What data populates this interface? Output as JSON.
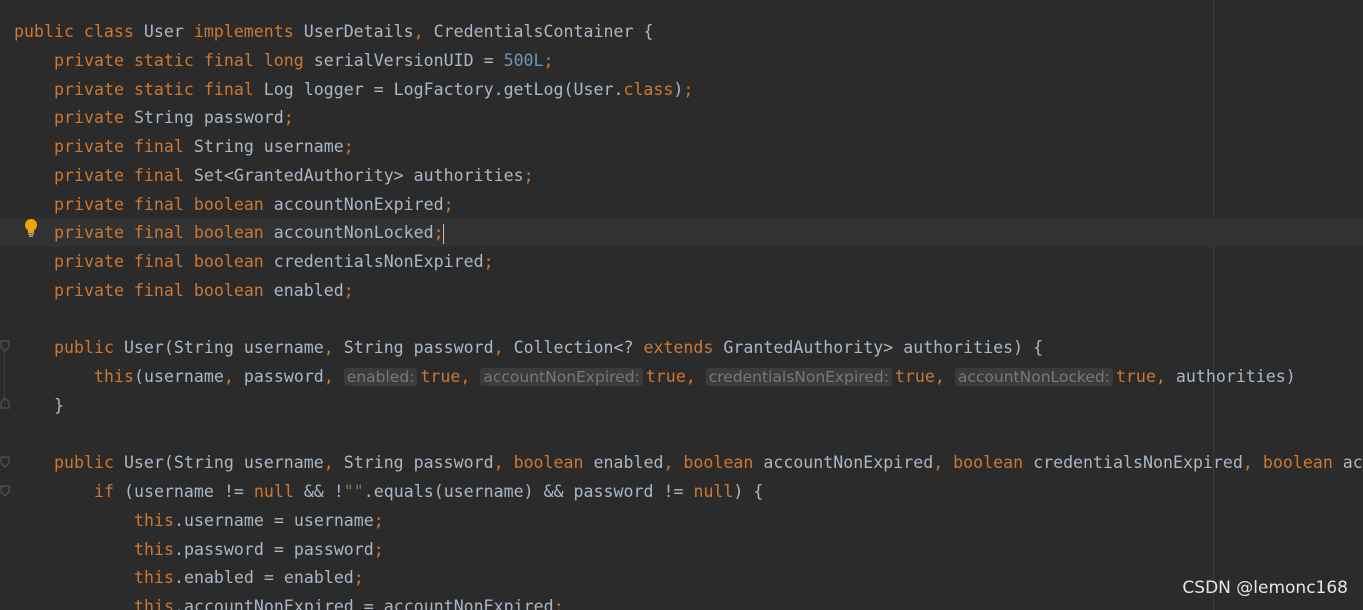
{
  "watermark": "CSDN @lemonc168",
  "colors": {
    "background": "#2b2b2b",
    "keyword": "#cc7832",
    "number": "#6897bb",
    "string": "#6a8759",
    "plain": "#a9b7c6",
    "hint": "#787878"
  },
  "icons": {
    "bulb": "lightbulb-icon",
    "fold": "fold-marker-icon"
  },
  "code": {
    "lines": [
      {
        "tokens": [
          {
            "k": "kw",
            "t": "public class "
          },
          {
            "k": "p",
            "t": "User "
          },
          {
            "k": "kw",
            "t": "implements "
          },
          {
            "k": "p",
            "t": "UserDetails"
          },
          {
            "k": "kw",
            "t": ", "
          },
          {
            "k": "p",
            "t": "CredentialsContainer {"
          }
        ]
      },
      {
        "tokens": [
          {
            "k": "kw",
            "t": "private static final long "
          },
          {
            "k": "p",
            "t": "serialVersionUID = "
          },
          {
            "k": "num",
            "t": "500L"
          },
          {
            "k": "kw",
            "t": ";"
          }
        ]
      },
      {
        "tokens": [
          {
            "k": "kw",
            "t": "private static final "
          },
          {
            "k": "p",
            "t": "Log logger = LogFactory.getLog(User."
          },
          {
            "k": "kw",
            "t": "class"
          },
          {
            "k": "p",
            "t": ")"
          },
          {
            "k": "kw",
            "t": ";"
          }
        ]
      },
      {
        "tokens": [
          {
            "k": "kw",
            "t": "private "
          },
          {
            "k": "p",
            "t": "String password"
          },
          {
            "k": "kw",
            "t": ";"
          }
        ]
      },
      {
        "tokens": [
          {
            "k": "kw",
            "t": "private final "
          },
          {
            "k": "p",
            "t": "String username"
          },
          {
            "k": "kw",
            "t": ";"
          }
        ]
      },
      {
        "tokens": [
          {
            "k": "kw",
            "t": "private final "
          },
          {
            "k": "p",
            "t": "Set<GrantedAuthority> authorities"
          },
          {
            "k": "kw",
            "t": ";"
          }
        ]
      },
      {
        "tokens": [
          {
            "k": "kw",
            "t": "private final boolean "
          },
          {
            "k": "p",
            "t": "accountNonExpired"
          },
          {
            "k": "kw",
            "t": ";"
          }
        ]
      },
      {
        "tokens": [
          {
            "k": "kw",
            "t": "private final boolean "
          },
          {
            "k": "p",
            "t": "accountNonLocked"
          },
          {
            "k": "kw",
            "t": ";"
          }
        ]
      },
      {
        "tokens": [
          {
            "k": "kw",
            "t": "private final boolean "
          },
          {
            "k": "p",
            "t": "credentialsNonExpired"
          },
          {
            "k": "kw",
            "t": ";"
          }
        ]
      },
      {
        "tokens": [
          {
            "k": "kw",
            "t": "private final boolean "
          },
          {
            "k": "p",
            "t": "enabled"
          },
          {
            "k": "kw",
            "t": ";"
          }
        ]
      },
      {
        "tokens": []
      },
      {
        "tokens": [
          {
            "k": "kw",
            "t": "public "
          },
          {
            "k": "p",
            "t": "User(String username"
          },
          {
            "k": "kw",
            "t": ", "
          },
          {
            "k": "p",
            "t": "String password"
          },
          {
            "k": "kw",
            "t": ", "
          },
          {
            "k": "p",
            "t": "Collection<? "
          },
          {
            "k": "kw",
            "t": "extends "
          },
          {
            "k": "p",
            "t": "GrantedAuthority> authorities) {"
          }
        ]
      },
      {
        "tokens": [
          {
            "k": "kw",
            "t": "this"
          },
          {
            "k": "p",
            "t": "(username"
          },
          {
            "k": "kw",
            "t": ", "
          },
          {
            "k": "p",
            "t": "password"
          },
          {
            "k": "kw",
            "t": ", "
          },
          {
            "k": "hint",
            "t": "enabled:"
          },
          {
            "k": "kw",
            "t": "true, "
          },
          {
            "k": "hint",
            "t": "accountNonExpired:"
          },
          {
            "k": "kw",
            "t": "true, "
          },
          {
            "k": "hint",
            "t": "credentialsNonExpired:"
          },
          {
            "k": "kw",
            "t": "true, "
          },
          {
            "k": "hint",
            "t": "accountNonLocked:"
          },
          {
            "k": "kw",
            "t": "true, "
          },
          {
            "k": "p",
            "t": "authorities)"
          }
        ]
      },
      {
        "tokens": [
          {
            "k": "p",
            "t": "}"
          }
        ]
      },
      {
        "tokens": []
      },
      {
        "tokens": [
          {
            "k": "kw",
            "t": "public "
          },
          {
            "k": "p",
            "t": "User(String username"
          },
          {
            "k": "kw",
            "t": ", "
          },
          {
            "k": "p",
            "t": "String password"
          },
          {
            "k": "kw",
            "t": ", boolean "
          },
          {
            "k": "p",
            "t": "enabled"
          },
          {
            "k": "kw",
            "t": ", boolean "
          },
          {
            "k": "p",
            "t": "accountNonExpired"
          },
          {
            "k": "kw",
            "t": ", boolean "
          },
          {
            "k": "p",
            "t": "credentialsNonExpired"
          },
          {
            "k": "kw",
            "t": ", boolean "
          },
          {
            "k": "p",
            "t": "ac"
          }
        ]
      },
      {
        "tokens": [
          {
            "k": "kw",
            "t": "if "
          },
          {
            "k": "p",
            "t": "(username != "
          },
          {
            "k": "kw",
            "t": "null "
          },
          {
            "k": "p",
            "t": "&& !"
          },
          {
            "k": "str",
            "t": "\"\""
          },
          {
            "k": "p",
            "t": ".equals(username) && password != "
          },
          {
            "k": "kw",
            "t": "null"
          },
          {
            "k": "p",
            "t": ") {"
          }
        ]
      },
      {
        "tokens": [
          {
            "k": "kw",
            "t": "this"
          },
          {
            "k": "p",
            "t": ".username = username"
          },
          {
            "k": "kw",
            "t": ";"
          }
        ]
      },
      {
        "tokens": [
          {
            "k": "kw",
            "t": "this"
          },
          {
            "k": "p",
            "t": ".password = password"
          },
          {
            "k": "kw",
            "t": ";"
          }
        ]
      },
      {
        "tokens": [
          {
            "k": "kw",
            "t": "this"
          },
          {
            "k": "p",
            "t": ".enabled = enabled"
          },
          {
            "k": "kw",
            "t": ";"
          }
        ]
      },
      {
        "tokens": [
          {
            "k": "kw",
            "t": "this"
          },
          {
            "k": "p",
            "t": ".accountNonExpired = accountNonExpired"
          },
          {
            "k": "kw",
            "t": ";"
          }
        ]
      }
    ]
  }
}
